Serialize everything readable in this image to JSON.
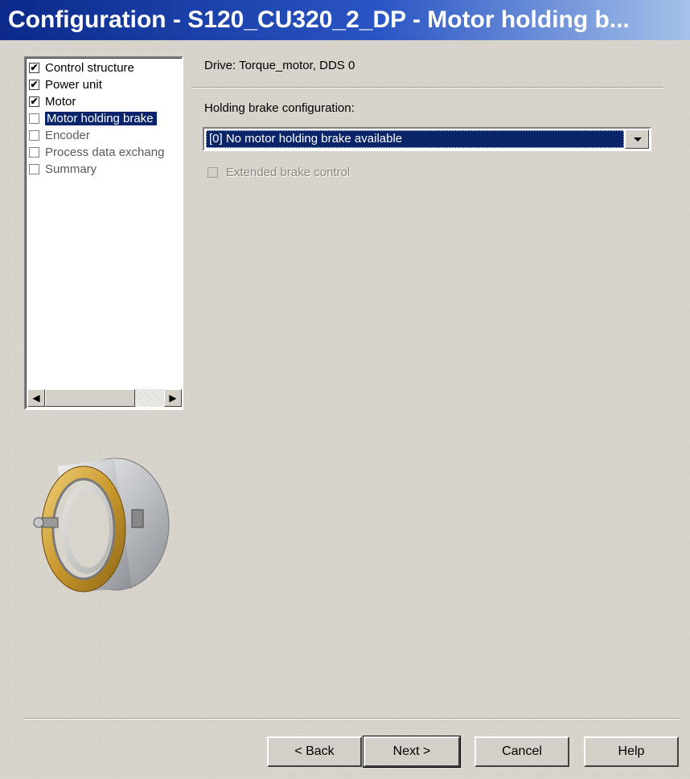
{
  "window": {
    "title": "Configuration - S120_CU320_2_DP - Motor holding b..."
  },
  "tree": {
    "items": [
      {
        "label": "Control structure",
        "checked": true,
        "selected": false
      },
      {
        "label": "Power unit",
        "checked": true,
        "selected": false
      },
      {
        "label": "Motor",
        "checked": true,
        "selected": false
      },
      {
        "label": "Motor holding brake",
        "checked": false,
        "selected": true
      },
      {
        "label": "Encoder",
        "checked": false,
        "selected": false
      },
      {
        "label": "Process data exchang",
        "checked": false,
        "selected": false
      },
      {
        "label": "Summary",
        "checked": false,
        "selected": false
      }
    ],
    "scroll_left_icon": "arrow-left-icon",
    "scroll_right_icon": "arrow-right-icon"
  },
  "main": {
    "drive_text": "Drive: Torque_motor, DDS 0",
    "holding_brake_label": "Holding brake configuration:",
    "holding_brake_value": "[0] No motor holding brake available",
    "extended_brake_label": "Extended brake control",
    "extended_brake_checked": false,
    "extended_brake_enabled": false
  },
  "buttons": {
    "back": "< Back",
    "next": "Next >",
    "cancel": "Cancel",
    "help": "Help"
  },
  "colors": {
    "title_start": "#0b2a8a",
    "title_end": "#a6c2ea",
    "selection": "#0a246a",
    "dialog_bg": "#d9d5cd"
  }
}
